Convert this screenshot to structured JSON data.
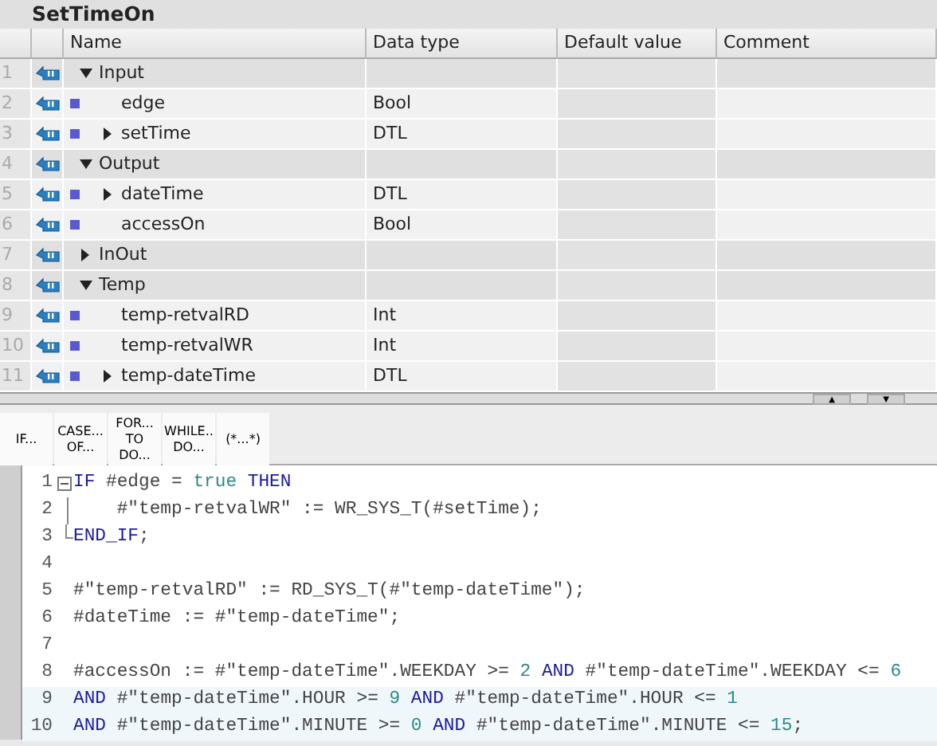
{
  "block_title": "SetTimeOn",
  "table": {
    "columns": [
      "Name",
      "Data type",
      "Default value",
      "Comment"
    ],
    "rows": [
      {
        "number": "1",
        "name": "Input",
        "expanded": true,
        "children": [
          {
            "number": "2",
            "name": "edge",
            "data_type": "Bool"
          },
          {
            "number": "3",
            "name": "setTime",
            "data_type": "DTL",
            "expanded": false
          }
        ]
      },
      {
        "number": "4",
        "name": "Output",
        "expanded": true,
        "children": [
          {
            "number": "5",
            "name": "dateTime",
            "data_type": "DTL",
            "expanded": false
          },
          {
            "number": "6",
            "name": "accessOn",
            "data_type": "Bool"
          }
        ]
      },
      {
        "number": "7",
        "name": "InOut",
        "expanded": false
      },
      {
        "number": "8",
        "name": "Temp",
        "expanded": true,
        "children": [
          {
            "number": "9",
            "name": "temp-retvalRD",
            "data_type": "Int"
          },
          {
            "number": "10",
            "name": "temp-retvalWR",
            "data_type": "Int"
          },
          {
            "number": "11",
            "name": "temp-dateTime",
            "data_type": "DTL",
            "expanded": false
          }
        ]
      }
    ]
  },
  "scroll_buttons": [
    "▲",
    "▼"
  ],
  "toolbar": [
    [
      "IF..."
    ],
    [
      "CASE...",
      "OF..."
    ],
    [
      "FOR...",
      "TO DO..."
    ],
    [
      "WHILE..",
      "DO..."
    ],
    [
      "(*...*)"
    ]
  ],
  "code": [
    {
      "number": "1",
      "expanded": true,
      "tokens": [
        {
          "kind": "keyword",
          "text": "IF"
        },
        {
          "kind": "plain",
          "text": " #edge = "
        },
        {
          "kind": "literal",
          "text": "true"
        },
        {
          "kind": "keyword",
          "text": " THEN"
        }
      ]
    },
    {
      "number": "2",
      "in_fold": true,
      "tokens": [
        {
          "kind": "plain",
          "text": "    #\"temp-retvalWR\" := WR_SYS_T(#setTime);"
        }
      ]
    },
    {
      "number": "3",
      "in_fold": true,
      "tokens": [
        {
          "kind": "keyword",
          "text": "END_IF"
        },
        {
          "kind": "plain",
          "text": ";"
        }
      ]
    },
    {
      "number": "4"
    },
    {
      "number": "5",
      "tokens": [
        {
          "kind": "plain",
          "text": "#\"temp-retvalRD\" := RD_SYS_T(#\"temp-dateTime\");"
        }
      ]
    },
    {
      "number": "6",
      "tokens": [
        {
          "kind": "plain",
          "text": "#dateTime := #\"temp-dateTime\";"
        }
      ]
    },
    {
      "number": "7"
    },
    {
      "number": "8",
      "tokens": [
        {
          "kind": "plain",
          "text": "#accessOn := #\"temp-dateTime\".WEEKDAY >= "
        },
        {
          "kind": "literal",
          "text": "2"
        },
        {
          "kind": "keyword",
          "text": " AND"
        },
        {
          "kind": "plain",
          "text": " #\"temp-dateTime\".WEEKDAY <= "
        },
        {
          "kind": "literal",
          "text": "6"
        }
      ]
    },
    {
      "number": "9",
      "highlighted": true,
      "tokens": [
        {
          "kind": "keyword",
          "text": "AND"
        },
        {
          "kind": "plain",
          "text": " #\"temp-dateTime\".HOUR >= "
        },
        {
          "kind": "literal",
          "text": "9"
        },
        {
          "kind": "keyword",
          "text": " AND"
        },
        {
          "kind": "plain",
          "text": " #\"temp-dateTime\".HOUR <= "
        },
        {
          "kind": "literal",
          "text": "1"
        }
      ]
    },
    {
      "number": "10",
      "highlighted": true,
      "tokens": [
        {
          "kind": "keyword",
          "text": "AND"
        },
        {
          "kind": "plain",
          "text": " #\"temp-dateTime\".MINUTE >= "
        },
        {
          "kind": "literal",
          "text": "0"
        },
        {
          "kind": "keyword",
          "text": " AND"
        },
        {
          "kind": "plain",
          "text": " #\"temp-dateTime\".MINUTE <= "
        },
        {
          "kind": "literal",
          "text": "15"
        },
        {
          "kind": "plain",
          "text": ";"
        }
      ]
    }
  ]
}
